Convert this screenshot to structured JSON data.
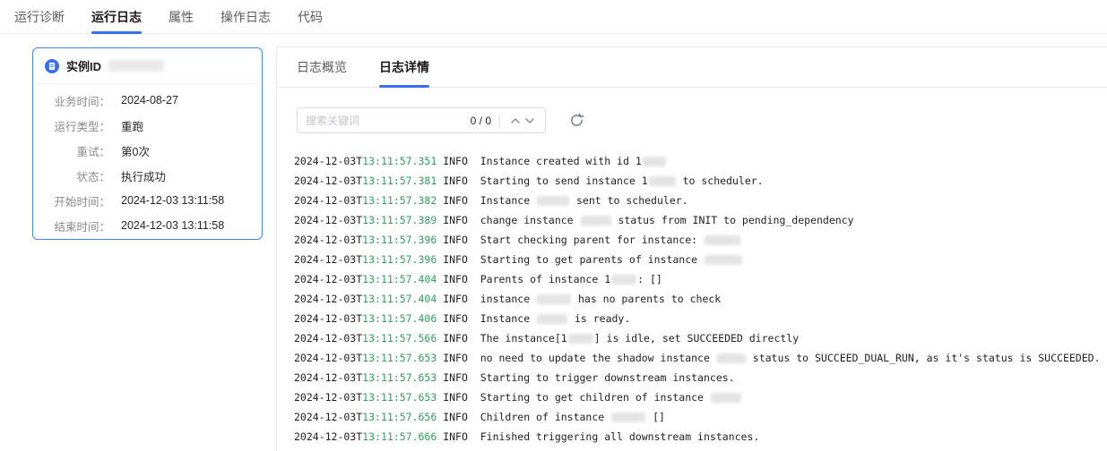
{
  "top_tabs": {
    "items": [
      {
        "label": "运行诊断",
        "active": false
      },
      {
        "label": "运行日志",
        "active": true
      },
      {
        "label": "属性",
        "active": false
      },
      {
        "label": "操作日志",
        "active": false
      },
      {
        "label": "代码",
        "active": false
      }
    ]
  },
  "instance_card": {
    "title": "实例ID",
    "id_redacted": true,
    "fields": [
      {
        "label": "业务时间：",
        "value": "2024-08-27"
      },
      {
        "label": "运行类型：",
        "value": "重跑"
      },
      {
        "label": "重试：",
        "value": "第0次"
      },
      {
        "label": "状态：",
        "value": "执行成功"
      },
      {
        "label": "开始时间：",
        "value": "2024-12-03 13:11:58"
      },
      {
        "label": "结束时间：",
        "value": "2024-12-03 13:11:58"
      }
    ]
  },
  "log_panel": {
    "tabs": [
      {
        "label": "日志概览",
        "active": false
      },
      {
        "label": "日志详情",
        "active": true
      }
    ],
    "search": {
      "placeholder": "搜索关键词",
      "counter": "0 / 0",
      "icons": [
        "chevron-up-icon",
        "chevron-down-icon",
        "refresh-icon"
      ]
    },
    "logs": {
      "date": "2024-12-03T",
      "level": "INFO",
      "entries": [
        {
          "time": "13:11:57.351",
          "parts": [
            {
              "t": "Instance created with id 1"
            },
            {
              "r": 26
            }
          ]
        },
        {
          "time": "13:11:57.381",
          "parts": [
            {
              "t": "Starting to send instance 1"
            },
            {
              "r": 30
            },
            {
              "t": " to scheduler."
            }
          ]
        },
        {
          "time": "13:11:57.382",
          "parts": [
            {
              "t": "Instance "
            },
            {
              "r": 36
            },
            {
              "t": " sent to scheduler."
            }
          ]
        },
        {
          "time": "13:11:57.389",
          "parts": [
            {
              "t": "change instance "
            },
            {
              "r": 34
            },
            {
              "t": " status from INIT to pending_dependency"
            }
          ]
        },
        {
          "time": "13:11:57.396",
          "parts": [
            {
              "t": "Start checking parent for instance: "
            },
            {
              "r": 40
            }
          ]
        },
        {
          "time": "13:11:57.396",
          "parts": [
            {
              "t": "Starting to get parents of instance "
            },
            {
              "r": 42
            }
          ]
        },
        {
          "time": "13:11:57.404",
          "parts": [
            {
              "t": "Parents of instance 1"
            },
            {
              "r": 28
            },
            {
              "t": ": []"
            }
          ]
        },
        {
          "time": "13:11:57.404",
          "parts": [
            {
              "t": "instance "
            },
            {
              "r": 38
            },
            {
              "t": " has no parents to check"
            }
          ]
        },
        {
          "time": "13:11:57.406",
          "parts": [
            {
              "t": "Instance "
            },
            {
              "r": 34
            },
            {
              "t": " is ready."
            }
          ]
        },
        {
          "time": "13:11:57.566",
          "parts": [
            {
              "t": "The instance[1"
            },
            {
              "r": 28
            },
            {
              "t": "] is idle, set SUCCEEDED directly"
            }
          ]
        },
        {
          "time": "13:11:57.653",
          "parts": [
            {
              "t": "no need to update the shadow instance "
            },
            {
              "r": 32
            },
            {
              "t": " status to SUCCEED_DUAL_RUN, as it's status is SUCCEEDED."
            }
          ]
        },
        {
          "time": "13:11:57.653",
          "parts": [
            {
              "t": "Starting to trigger downstream instances."
            }
          ]
        },
        {
          "time": "13:11:57.653",
          "parts": [
            {
              "t": "Starting to get children of instance "
            },
            {
              "r": 34
            }
          ]
        },
        {
          "time": "13:11:57.656",
          "parts": [
            {
              "t": "Children of instance "
            },
            {
              "r": 38
            },
            {
              "t": " []"
            }
          ]
        },
        {
          "time": "13:11:57.666",
          "parts": [
            {
              "t": "Finished triggering all downstream instances."
            }
          ]
        }
      ]
    }
  },
  "colors": {
    "accent": "#366ef4",
    "time_green": "#2e9e5c",
    "card_border": "#4a80f0"
  }
}
